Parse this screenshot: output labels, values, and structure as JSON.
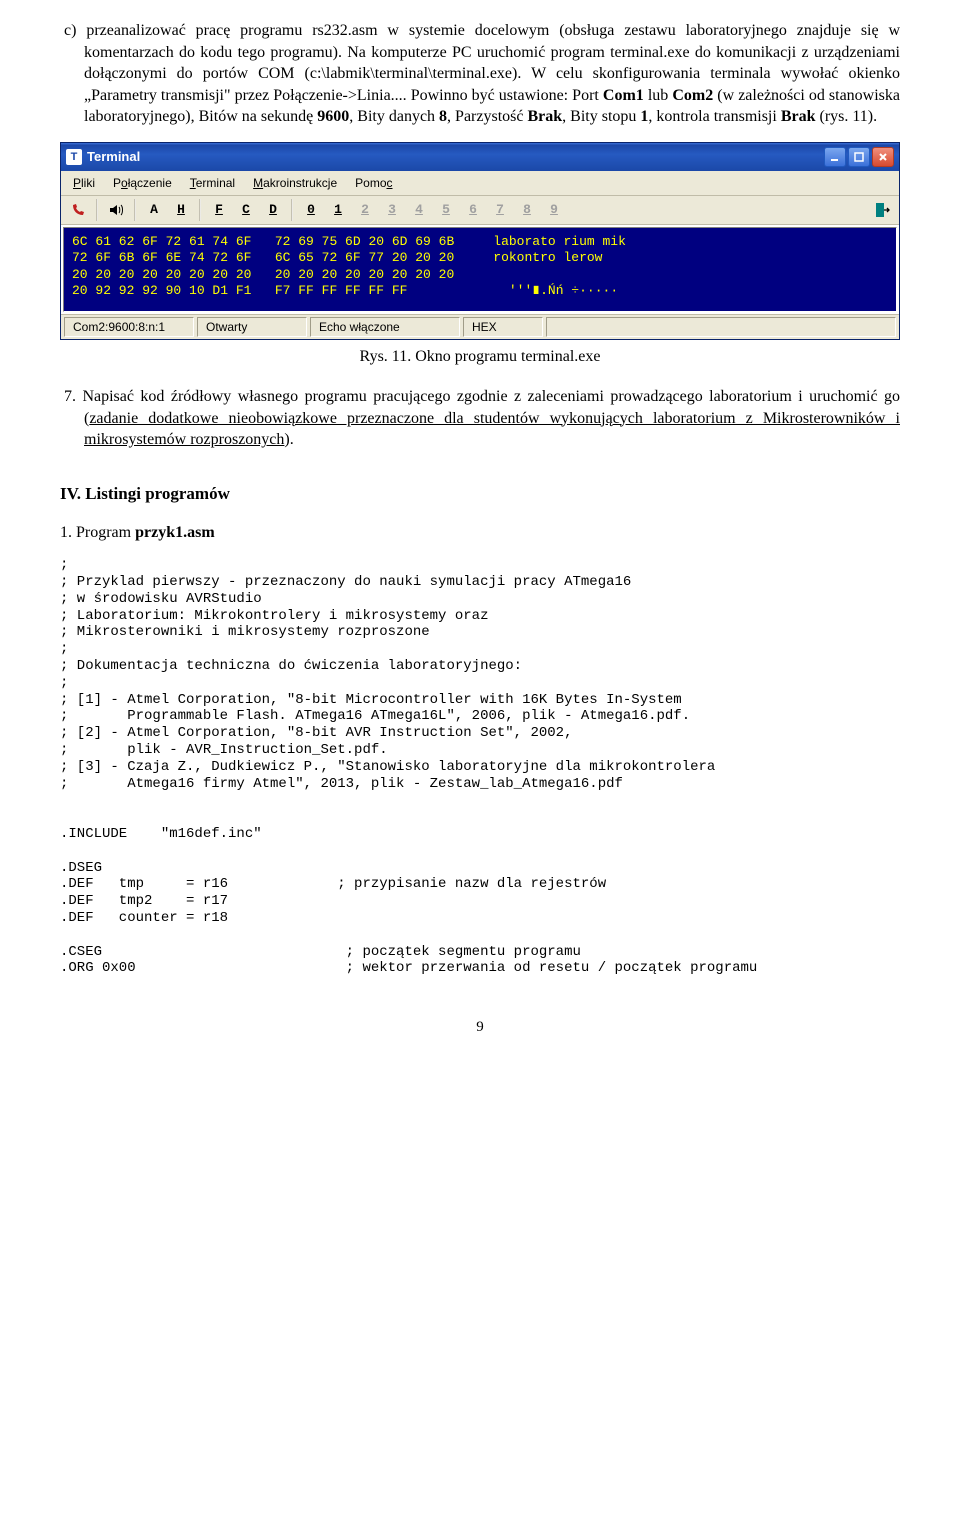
{
  "para_c_prefix": "c)",
  "para_c": "przeanalizować pracę programu rs232.asm w systemie docelowym (obsługa zestawu laboratoryjnego znajduje się w komentarzach do kodu tego programu). Na komputerze PC uruchomić program terminal.exe do komunikacji z urządzeniami dołączonymi do portów COM (c:\\labmik\\terminal\\terminal.exe). W celu skonfigurowania terminala wywołać okienko „Parametry transmisji\" przez Połączenie->Linia.... Powinno być ustawione: Port ",
  "para_c_bold1": "Com1",
  "para_c_mid1": " lub ",
  "para_c_bold2": "Com2",
  "para_c_mid2": " (w zależności od stanowiska laboratoryjnego), Bitów na sekundę ",
  "para_c_bold3": "9600",
  "para_c_mid3": ", Bity danych ",
  "para_c_bold4": "8",
  "para_c_mid4": ", Parzystość ",
  "para_c_bold5": "Brak",
  "para_c_mid5": ", Bity stopu ",
  "para_c_bold6": "1",
  "para_c_mid6": ", kontrola transmisji ",
  "para_c_bold7": "Brak",
  "para_c_end": " (rys. 11).",
  "terminal": {
    "title": "Terminal",
    "menu": {
      "pliki": "Pliki",
      "polaczenie": "Połączenie",
      "terminal": "Terminal",
      "makro": "Makroinstrukcje",
      "pomoc": "Pomoc"
    },
    "toolA": "A",
    "toolH": "H",
    "toolF": "F",
    "toolC": "C",
    "toolD": "D",
    "tool0": "0",
    "tool1": "1",
    "tool2": "2",
    "tool3": "3",
    "tool4": "4",
    "tool5": "5",
    "tool6": "6",
    "tool7": "7",
    "tool8": "8",
    "tool9": "9",
    "body": "6C 61 62 6F 72 61 74 6F   72 69 75 6D 20 6D 69 6B     laborato rium mik\n72 6F 6B 6F 6E 74 72 6F   6C 65 72 6F 77 20 20 20     rokontro lerow\n20 20 20 20 20 20 20 20   20 20 20 20 20 20 20 20\n20 92 92 92 90 10 D1 F1   F7 FF FF FF FF FF             '''∎.Ńń ÷·····",
    "status": {
      "port": "Com2:9600:8:n:1",
      "state": "Otwarty",
      "echo": "Echo włączone",
      "mode": "HEX"
    }
  },
  "caption": "Rys. 11. Okno programu terminal.exe",
  "para7_prefix": "7.",
  "para7_a": "Napisać kod źródłowy własnego programu pracującego zgodnie z zaleceniami prowadzącego laboratorium i uruchomić go (",
  "para7_u": "zadanie dodatkowe nieobowiązkowe przeznaczone dla studentów wykonujących laboratorium z Mikrosterowników i mikrosystemów rozproszonych",
  "para7_b": ").",
  "section4": "IV. Listingi programów",
  "program1_a": "1. Program ",
  "program1_b": "przyk1.asm",
  "code": ";\n; Przyklad pierwszy - przeznaczony do nauki symulacji pracy ATmega16\n; w środowisku AVRStudio\n; Laboratorium: Mikrokontrolery i mikrosystemy oraz\n; Mikrosterowniki i mikrosystemy rozproszone\n;\n; Dokumentacja techniczna do ćwiczenia laboratoryjnego:\n;\n; [1] - Atmel Corporation, \"8-bit Microcontroller with 16K Bytes In-System\n;       Programmable Flash. ATmega16 ATmega16L\", 2006, plik - Atmega16.pdf.\n; [2] - Atmel Corporation, \"8-bit AVR Instruction Set\", 2002,\n;       plik - AVR_Instruction_Set.pdf.\n; [3] - Czaja Z., Dudkiewicz P., \"Stanowisko laboratoryjne dla mikrokontrolera\n;       Atmega16 firmy Atmel\", 2013, plik - Zestaw_lab_Atmega16.pdf\n\n\n.INCLUDE    \"m16def.inc\"\n\n.DSEG\n.DEF   tmp     = r16             ; przypisanie nazw dla rejestrów\n.DEF   tmp2    = r17\n.DEF   counter = r18\n\n.CSEG                             ; początek segmentu programu\n.ORG 0x00                         ; wektor przerwania od resetu / początek programu",
  "page_num": "9"
}
